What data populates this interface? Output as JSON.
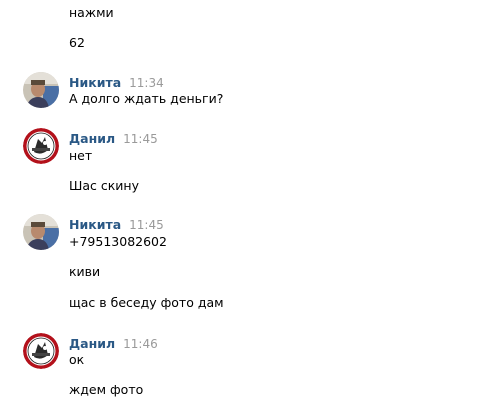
{
  "messages": {
    "m0_line0": "нажми",
    "m0_line1": "62",
    "m1": {
      "author": "Никита",
      "time": "11:34",
      "lines": [
        "А долго ждать деньги?"
      ]
    },
    "m2": {
      "author": "Данил",
      "time": "11:45",
      "lines": [
        "нет",
        "Шас скину"
      ]
    },
    "m3": {
      "author": "Никита",
      "time": "11:45",
      "lines": [
        "+79513082602",
        "киви",
        "щас в беседу фото дам"
      ]
    },
    "m4": {
      "author": "Данил",
      "time": "11:46",
      "lines": [
        "ок",
        "ждем фото"
      ]
    }
  },
  "colors": {
    "author": "#2a5885",
    "time": "#9a9a9a",
    "text": "#000000"
  }
}
